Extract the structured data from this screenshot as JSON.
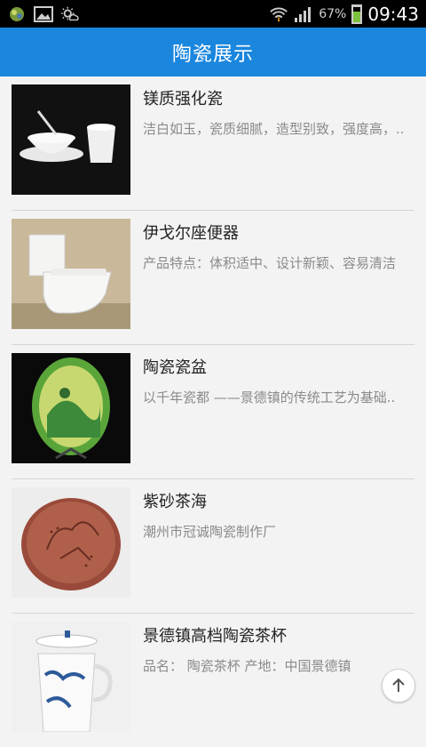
{
  "status_bar": {
    "battery_text": "67%",
    "time": "09:43",
    "battery_level": 0.67,
    "icons": [
      "app-icon",
      "gallery-icon",
      "weather-icon",
      "wifi-icon",
      "signal-icon",
      "battery-icon"
    ]
  },
  "header": {
    "title": "陶瓷展示"
  },
  "items": [
    {
      "title": "镁质强化瓷",
      "desc": "洁白如玉，瓷质细腻，造型别致，强度高，.."
    },
    {
      "title": "伊戈尔座便器",
      "desc": "产品特点：体积适中、设计新颖、容易清洁"
    },
    {
      "title": "陶瓷瓷盆",
      "desc": "以千年瓷都 ——景德镇的传统工艺为基础.."
    },
    {
      "title": "紫砂茶海",
      "desc": "潮州市冠诚陶瓷制作厂"
    },
    {
      "title": "景德镇高档陶瓷茶杯",
      "desc": "品名： 陶瓷茶杯 产地：中国景德镇"
    }
  ],
  "colors": {
    "header": "#1a86de",
    "background": "#f3f3f3",
    "title": "#222222",
    "desc": "#8a8a8a"
  },
  "scroll_top_icon": "arrow-up-icon"
}
